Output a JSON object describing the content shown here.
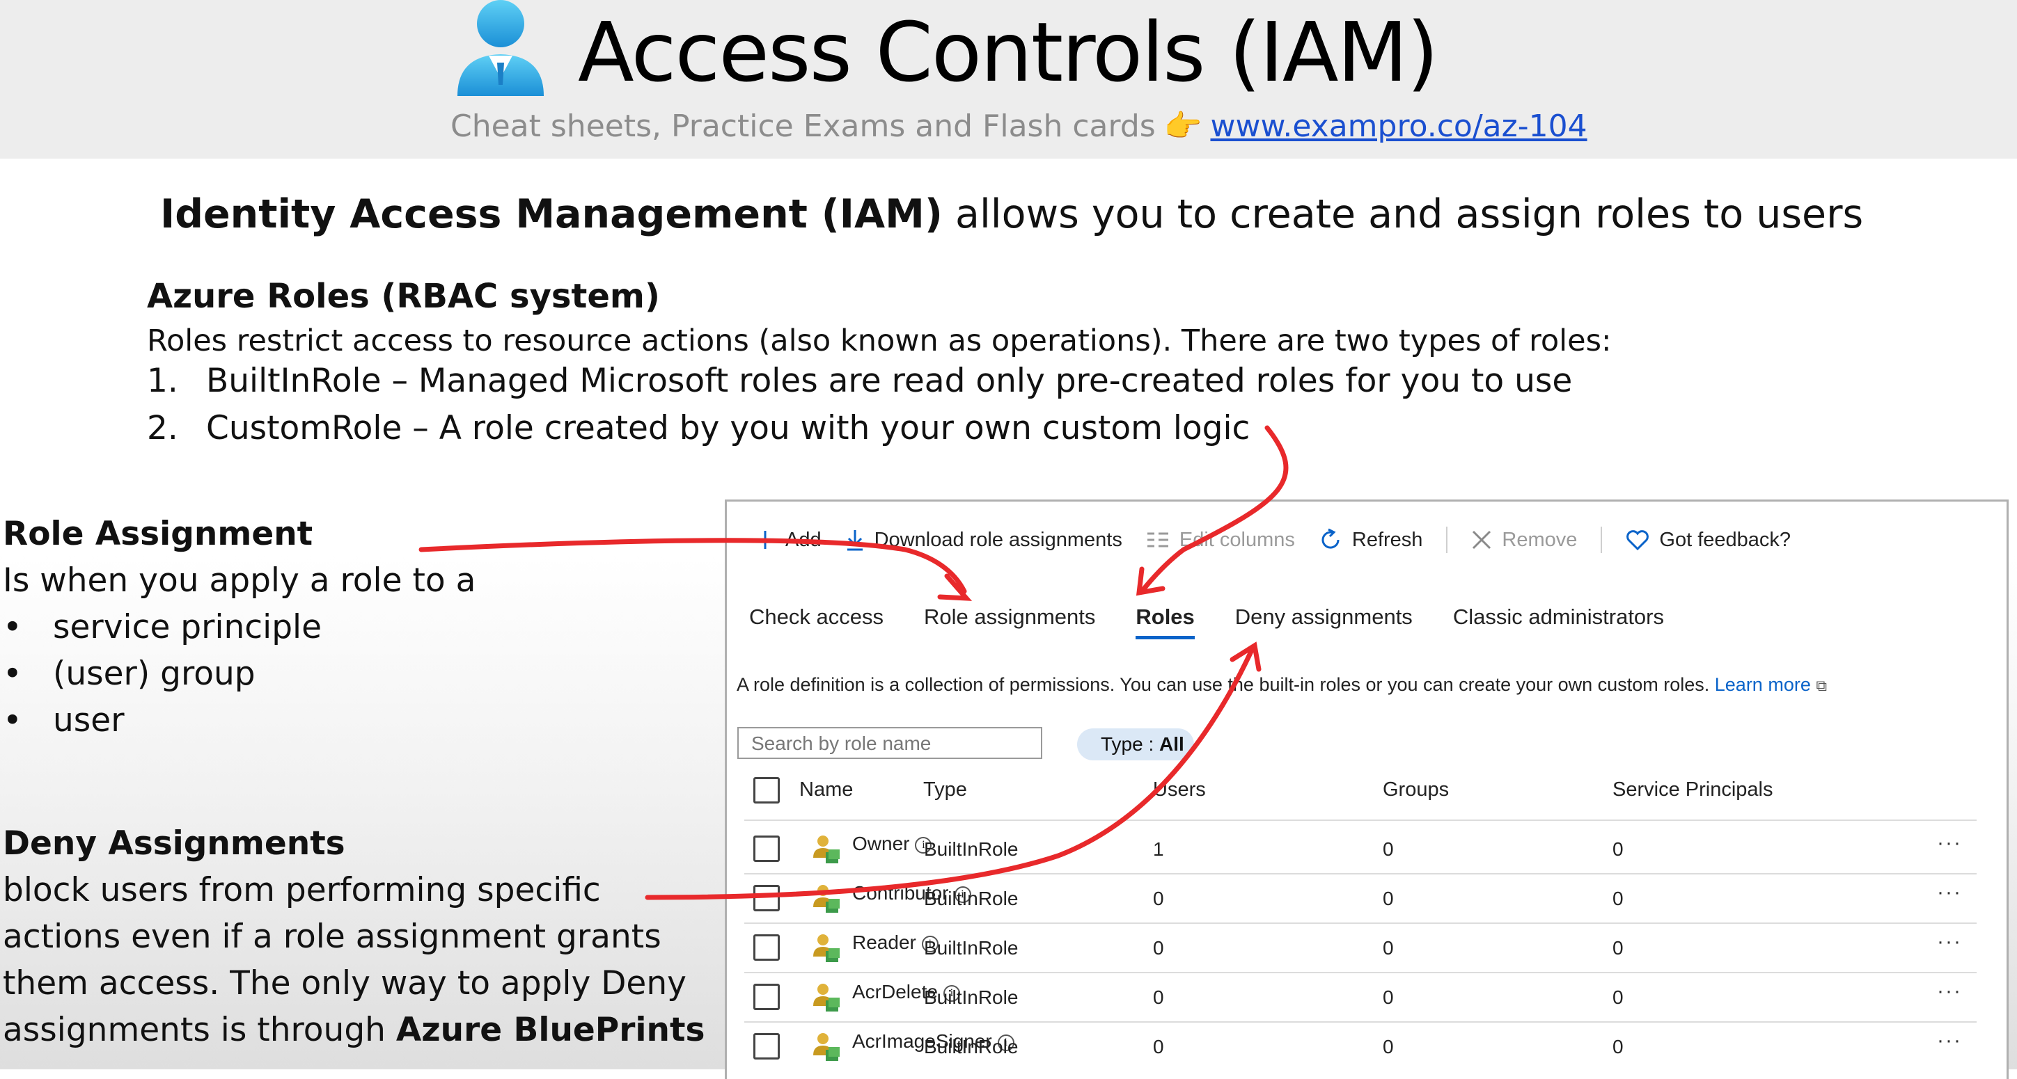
{
  "banner": {
    "title": "Access Controls (IAM)",
    "subtitle": "Cheat sheets, Practice Exams and Flash cards",
    "subtitle_link": "www.exampro.co/az-104"
  },
  "headline": {
    "bold": "Identity Access Management (IAM)",
    "rest": " allows you to create and assign roles to users"
  },
  "azure_roles": {
    "title": "Azure Roles (RBAC system)",
    "desc": "Roles restrict access to resource actions (also known as operations). There are two types of roles:",
    "items": [
      {
        "num": "1.",
        "text": "BuiltInRole – Managed Microsoft roles are read only pre-created roles for you to use"
      },
      {
        "num": "2.",
        "text": "CustomRole – A role created by you with your own custom logic"
      }
    ]
  },
  "role_assignment": {
    "title": "Role Assignment",
    "desc": "Is when you apply a role to a",
    "bullets": [
      "service principle",
      "(user) group",
      "user"
    ]
  },
  "deny_assignments": {
    "title": "Deny Assignments",
    "lines": [
      "block users from performing specific",
      "actions even if a role assignment grants",
      "them access. The only way to apply Deny"
    ],
    "last_prefix": "assignments is through ",
    "last_bold": "Azure BluePrints"
  },
  "panel": {
    "toolbar": {
      "add": "Add",
      "download": "Download role assignments",
      "edit_columns": "Edit columns",
      "refresh": "Refresh",
      "remove": "Remove",
      "feedback": "Got feedback?"
    },
    "tabs": [
      "Check access",
      "Role assignments",
      "Roles",
      "Deny assignments",
      "Classic administrators"
    ],
    "active_tab": "Roles",
    "description": "A role definition is a collection of permissions. You can use the built-in roles or you can create your own custom roles.",
    "learn_more": "Learn more",
    "search_placeholder": "Search by role name",
    "filter_label": "Type : ",
    "filter_value": "All",
    "columns": [
      "Name",
      "Type",
      "Users",
      "Groups",
      "Service Principals"
    ],
    "rows": [
      {
        "name": "Owner",
        "type": "BuiltInRole",
        "users": "1",
        "groups": "0",
        "sp": "0",
        "more": "···"
      },
      {
        "name": "Contributor",
        "type": "BuiltInRole",
        "users": "0",
        "groups": "0",
        "sp": "0",
        "more": "···"
      },
      {
        "name": "Reader",
        "type": "BuiltInRole",
        "users": "0",
        "groups": "0",
        "sp": "0",
        "more": "···"
      },
      {
        "name": "AcrDelete",
        "type": "BuiltInRole",
        "users": "0",
        "groups": "0",
        "sp": "0",
        "more": "···"
      },
      {
        "name": "AcrImageSigner",
        "type": "BuiltInRole",
        "users": "0",
        "groups": "0",
        "sp": "0",
        "more": "···"
      }
    ]
  },
  "colors": {
    "accent_blue": "#0a63c9",
    "annotation_red": "#e8292b",
    "link_blue": "#1a4fd0"
  }
}
